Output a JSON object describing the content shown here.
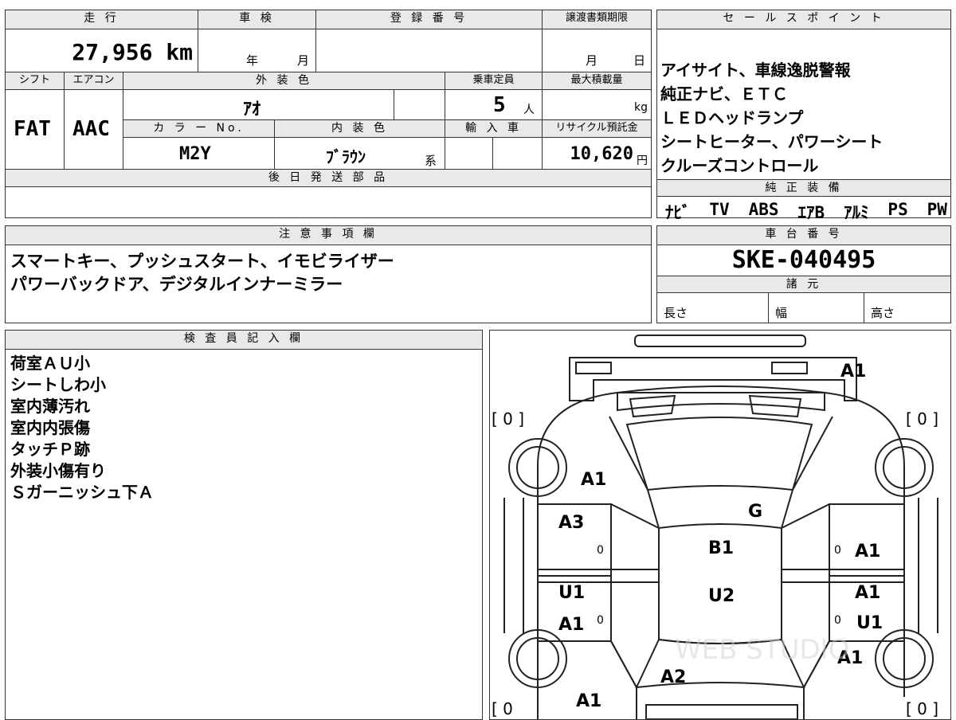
{
  "vehicle": {
    "mileage_label": "走 行",
    "mileage": "27,956 km",
    "shaken_label": "車 検",
    "shaken_year": "年",
    "shaken_month": "月",
    "registration_label": "登 録 番 号",
    "transfer_label": "譲渡書類期限",
    "transfer_month": "月",
    "transfer_day": "日",
    "shift_label": "シフト",
    "shift": "FAT",
    "aircon_label": "エアコン",
    "aircon": "AAC",
    "exterior_label": "外 装 色",
    "exterior_color": "ｱｵ",
    "color_no_label": "カ ラ ー No.",
    "color_no": "M2Y",
    "interior_label": "内 装 色",
    "interior_color": "ﾌﾞﾗｳﾝ",
    "interior_suffix": "系",
    "capacity_label": "乗車定員",
    "capacity": "5",
    "capacity_unit": "人",
    "load_label": "最大積載量",
    "load_unit": "kg",
    "import_label": "輸 入 車",
    "recycle_label": "リサイクル預託金",
    "recycle_fee": "10,620",
    "recycle_unit": "円"
  },
  "later_parts": {
    "label": "後 日 発 送 部 品"
  },
  "sales_points": {
    "label": "セ ー ル ス ポ イ ン ト",
    "lines": [
      "アイサイト、車線逸脱警報",
      "純正ナビ、ＥＴＣ",
      "ＬＥＤヘッドランプ",
      "シートヒーター、パワーシート",
      "クルーズコントロール"
    ]
  },
  "equipment": {
    "label": "純 正 装 備",
    "items": [
      "ﾅﾋﾞ",
      "TV",
      "ABS",
      "ｴｱB",
      "ｱﾙﾐ",
      "PS",
      "PW"
    ]
  },
  "notes": {
    "label": "注 意 事 項 欄",
    "lines": [
      "スマートキー、プッシュスタート、イモビライザー",
      "パワーバックドア、デジタルインナーミラー"
    ]
  },
  "chassis": {
    "label": "車 台 番 号",
    "number": "SKE-040495",
    "spec_label": "諸 元",
    "length_label": "長さ",
    "width_label": "幅",
    "height_label": "高さ"
  },
  "inspector": {
    "label": "検 査 員 記 入 欄",
    "lines": [
      "荷室ＡＵ小",
      "シートしわ小",
      "室内薄汚れ",
      "室内内張傷",
      "タッチＰ跡",
      "外装小傷有り",
      "Ｓガーニッシュ下Ａ"
    ]
  },
  "diagram": {
    "tire_marks": [
      "[ 0 ]",
      "[ 0 ]",
      "[ 0",
      "[ 0 ]"
    ],
    "small_zeros": [
      "0",
      "0",
      "0",
      "0"
    ],
    "labels": [
      "A1",
      "A1",
      "G",
      "A3",
      "B1",
      "A1",
      "U1",
      "U2",
      "A1",
      "A1",
      "U1",
      "A1",
      "A2",
      "A1"
    ],
    "watermark": "WEB STUDIO"
  }
}
